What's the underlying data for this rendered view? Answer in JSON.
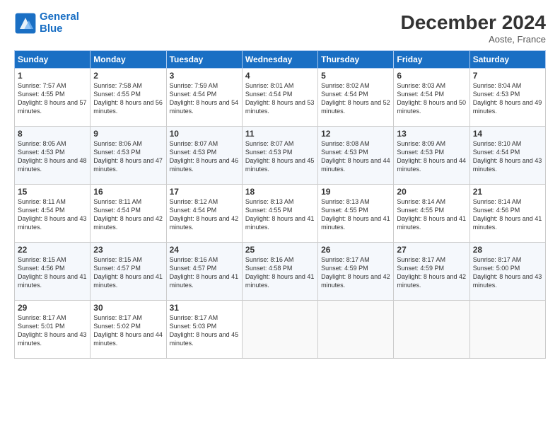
{
  "logo": {
    "line1": "General",
    "line2": "Blue"
  },
  "title": "December 2024",
  "location": "Aoste, France",
  "days_of_week": [
    "Sunday",
    "Monday",
    "Tuesday",
    "Wednesday",
    "Thursday",
    "Friday",
    "Saturday"
  ],
  "weeks": [
    [
      {
        "day": "1",
        "sunrise": "7:57 AM",
        "sunset": "4:55 PM",
        "daylight": "8 hours and 57 minutes."
      },
      {
        "day": "2",
        "sunrise": "7:58 AM",
        "sunset": "4:55 PM",
        "daylight": "8 hours and 56 minutes."
      },
      {
        "day": "3",
        "sunrise": "7:59 AM",
        "sunset": "4:54 PM",
        "daylight": "8 hours and 54 minutes."
      },
      {
        "day": "4",
        "sunrise": "8:01 AM",
        "sunset": "4:54 PM",
        "daylight": "8 hours and 53 minutes."
      },
      {
        "day": "5",
        "sunrise": "8:02 AM",
        "sunset": "4:54 PM",
        "daylight": "8 hours and 52 minutes."
      },
      {
        "day": "6",
        "sunrise": "8:03 AM",
        "sunset": "4:54 PM",
        "daylight": "8 hours and 50 minutes."
      },
      {
        "day": "7",
        "sunrise": "8:04 AM",
        "sunset": "4:53 PM",
        "daylight": "8 hours and 49 minutes."
      }
    ],
    [
      {
        "day": "8",
        "sunrise": "8:05 AM",
        "sunset": "4:53 PM",
        "daylight": "8 hours and 48 minutes."
      },
      {
        "day": "9",
        "sunrise": "8:06 AM",
        "sunset": "4:53 PM",
        "daylight": "8 hours and 47 minutes."
      },
      {
        "day": "10",
        "sunrise": "8:07 AM",
        "sunset": "4:53 PM",
        "daylight": "8 hours and 46 minutes."
      },
      {
        "day": "11",
        "sunrise": "8:07 AM",
        "sunset": "4:53 PM",
        "daylight": "8 hours and 45 minutes."
      },
      {
        "day": "12",
        "sunrise": "8:08 AM",
        "sunset": "4:53 PM",
        "daylight": "8 hours and 44 minutes."
      },
      {
        "day": "13",
        "sunrise": "8:09 AM",
        "sunset": "4:53 PM",
        "daylight": "8 hours and 44 minutes."
      },
      {
        "day": "14",
        "sunrise": "8:10 AM",
        "sunset": "4:54 PM",
        "daylight": "8 hours and 43 minutes."
      }
    ],
    [
      {
        "day": "15",
        "sunrise": "8:11 AM",
        "sunset": "4:54 PM",
        "daylight": "8 hours and 43 minutes."
      },
      {
        "day": "16",
        "sunrise": "8:11 AM",
        "sunset": "4:54 PM",
        "daylight": "8 hours and 42 minutes."
      },
      {
        "day": "17",
        "sunrise": "8:12 AM",
        "sunset": "4:54 PM",
        "daylight": "8 hours and 42 minutes."
      },
      {
        "day": "18",
        "sunrise": "8:13 AM",
        "sunset": "4:55 PM",
        "daylight": "8 hours and 41 minutes."
      },
      {
        "day": "19",
        "sunrise": "8:13 AM",
        "sunset": "4:55 PM",
        "daylight": "8 hours and 41 minutes."
      },
      {
        "day": "20",
        "sunrise": "8:14 AM",
        "sunset": "4:55 PM",
        "daylight": "8 hours and 41 minutes."
      },
      {
        "day": "21",
        "sunrise": "8:14 AM",
        "sunset": "4:56 PM",
        "daylight": "8 hours and 41 minutes."
      }
    ],
    [
      {
        "day": "22",
        "sunrise": "8:15 AM",
        "sunset": "4:56 PM",
        "daylight": "8 hours and 41 minutes."
      },
      {
        "day": "23",
        "sunrise": "8:15 AM",
        "sunset": "4:57 PM",
        "daylight": "8 hours and 41 minutes."
      },
      {
        "day": "24",
        "sunrise": "8:16 AM",
        "sunset": "4:57 PM",
        "daylight": "8 hours and 41 minutes."
      },
      {
        "day": "25",
        "sunrise": "8:16 AM",
        "sunset": "4:58 PM",
        "daylight": "8 hours and 41 minutes."
      },
      {
        "day": "26",
        "sunrise": "8:17 AM",
        "sunset": "4:59 PM",
        "daylight": "8 hours and 42 minutes."
      },
      {
        "day": "27",
        "sunrise": "8:17 AM",
        "sunset": "4:59 PM",
        "daylight": "8 hours and 42 minutes."
      },
      {
        "day": "28",
        "sunrise": "8:17 AM",
        "sunset": "5:00 PM",
        "daylight": "8 hours and 43 minutes."
      }
    ],
    [
      {
        "day": "29",
        "sunrise": "8:17 AM",
        "sunset": "5:01 PM",
        "daylight": "8 hours and 43 minutes."
      },
      {
        "day": "30",
        "sunrise": "8:17 AM",
        "sunset": "5:02 PM",
        "daylight": "8 hours and 44 minutes."
      },
      {
        "day": "31",
        "sunrise": "8:17 AM",
        "sunset": "5:03 PM",
        "daylight": "8 hours and 45 minutes."
      },
      null,
      null,
      null,
      null
    ]
  ]
}
